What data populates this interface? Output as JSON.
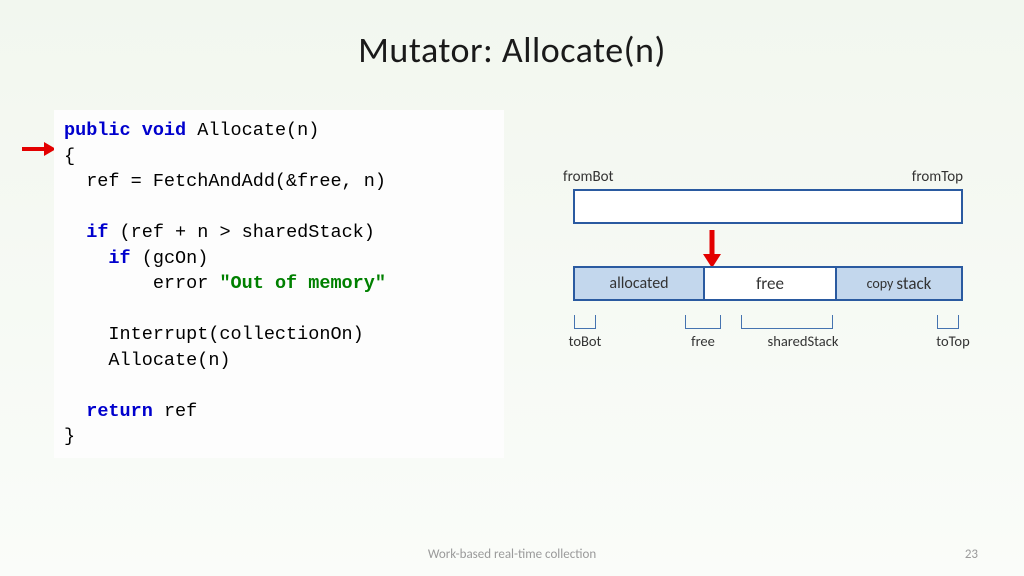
{
  "title": "Mutator: Allocate(n)",
  "code": {
    "line1_kw": "public void",
    "line1_rest": " Allocate(n)",
    "line2": "{",
    "line3": "  ref = FetchAndAdd(&free, n)",
    "line4": "",
    "line5_indent": "  ",
    "line5_kw": "if",
    "line5_rest": " (ref + n > sharedStack)",
    "line6_indent": "    ",
    "line6_kw": "if",
    "line6_rest": " (gcOn)",
    "line7_indent": "        error ",
    "line7_str": "\"Out of memory\"",
    "line8": "",
    "line9": "    Interrupt(collectionOn)",
    "line10": "    Allocate(n)",
    "line11": "",
    "line12_indent": "  ",
    "line12_kw": "return",
    "line12_rest": " ref",
    "line13": "}"
  },
  "diagram": {
    "fromBot": "fromBot",
    "fromTop": "fromTop",
    "allocated": "allocated",
    "free": "free",
    "copy": "copy",
    "stack": "stack",
    "toBot": "toBot",
    "freePtr": "free",
    "sharedStack": "sharedStack",
    "toTop": "toTop"
  },
  "footer": "Work-based real-time collection",
  "page": "23"
}
